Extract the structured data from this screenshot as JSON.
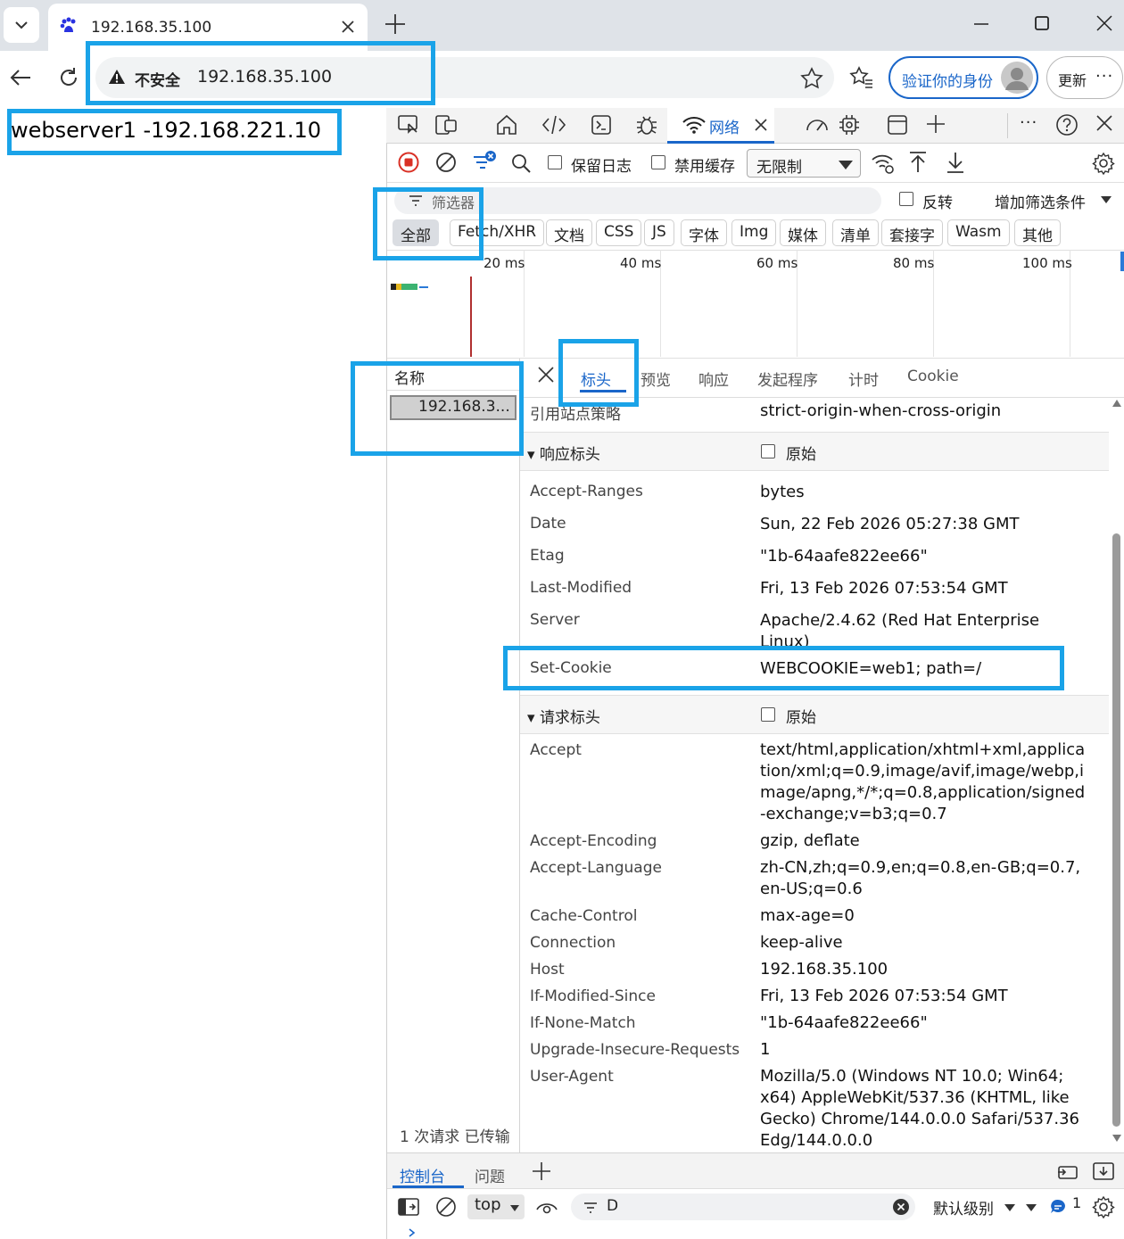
{
  "browser": {
    "tab_title": "192.168.35.100",
    "security_label": "不安全",
    "url": "192.168.35.100",
    "verify_label": "验证你的身份",
    "update_label": "更新",
    "more_label": "···"
  },
  "page": {
    "content_text": "webserver1 -192.168.221.10"
  },
  "devtools": {
    "network_tab": "网络",
    "toolbar": {
      "preserve_log": "保留日志",
      "disable_cache": "禁用缓存",
      "throttle": "无限制"
    },
    "filter": {
      "placeholder": "筛选器",
      "invert": "反转",
      "more_filters": "增加筛选条件"
    },
    "type_filters": [
      "全部",
      "Fetch/XHR",
      "文档",
      "CSS",
      "JS",
      "字体",
      "Img",
      "媒体",
      "清单",
      "套接字",
      "Wasm",
      "其他"
    ],
    "timeline_ticks": [
      "20 ms",
      "40 ms",
      "60 ms",
      "80 ms",
      "100 ms"
    ],
    "request_list": {
      "header": "名称",
      "rows": [
        "192.168.3..."
      ],
      "status": "1 次请求 已传输"
    },
    "detail_tabs": [
      "标头",
      "预览",
      "响应",
      "发起程序",
      "计时",
      "Cookie"
    ],
    "referrer_policy": {
      "name": "引用站点策略",
      "value": "strict-origin-when-cross-origin"
    },
    "response_headers": {
      "title": "▾ 响应标头",
      "raw": "原始",
      "items": [
        {
          "name": "Accept-Ranges",
          "value": "bytes"
        },
        {
          "name": "Date",
          "value": "Sun, 22 Feb 2026 05:27:38 GMT"
        },
        {
          "name": "Etag",
          "value": "\"1b-64aafe822ee66\""
        },
        {
          "name": "Last-Modified",
          "value": "Fri, 13 Feb 2026 07:53:54 GMT"
        },
        {
          "name": "Server",
          "value": "Apache/2.4.62 (Red Hat Enterprise Linux)"
        },
        {
          "name": "Set-Cookie",
          "value": "WEBCOOKIE=web1; path=/"
        }
      ]
    },
    "request_headers": {
      "title": "▾ 请求标头",
      "raw": "原始",
      "items": [
        {
          "name": "Accept",
          "value": "text/html,application/xhtml+xml,application/xml;q=0.9,image/avif,image/webp,image/apng,*/*;q=0.8,application/signed-exchange;v=b3;q=0.7"
        },
        {
          "name": "Accept-Encoding",
          "value": "gzip, deflate"
        },
        {
          "name": "Accept-Language",
          "value": "zh-CN,zh;q=0.9,en;q=0.8,en-GB;q=0.7,en-US;q=0.6"
        },
        {
          "name": "Cache-Control",
          "value": "max-age=0"
        },
        {
          "name": "Connection",
          "value": "keep-alive"
        },
        {
          "name": "Host",
          "value": "192.168.35.100"
        },
        {
          "name": "If-Modified-Since",
          "value": "Fri, 13 Feb 2026 07:53:54 GMT"
        },
        {
          "name": "If-None-Match",
          "value": "\"1b-64aafe822ee66\""
        },
        {
          "name": "Upgrade-Insecure-Requests",
          "value": "1"
        },
        {
          "name": "User-Agent",
          "value": "Mozilla/5.0 (Windows NT 10.0; Win64; x64) AppleWebKit/537.36 (KHTML, like Gecko) Chrome/144.0.0.0 Safari/537.36 Edg/144.0.0.0"
        }
      ]
    },
    "drawer": {
      "console_tab": "控制台",
      "issues_tab": "问题",
      "context": "top",
      "filter_text": "D",
      "levels": "默认级别",
      "message_count": "1"
    }
  }
}
